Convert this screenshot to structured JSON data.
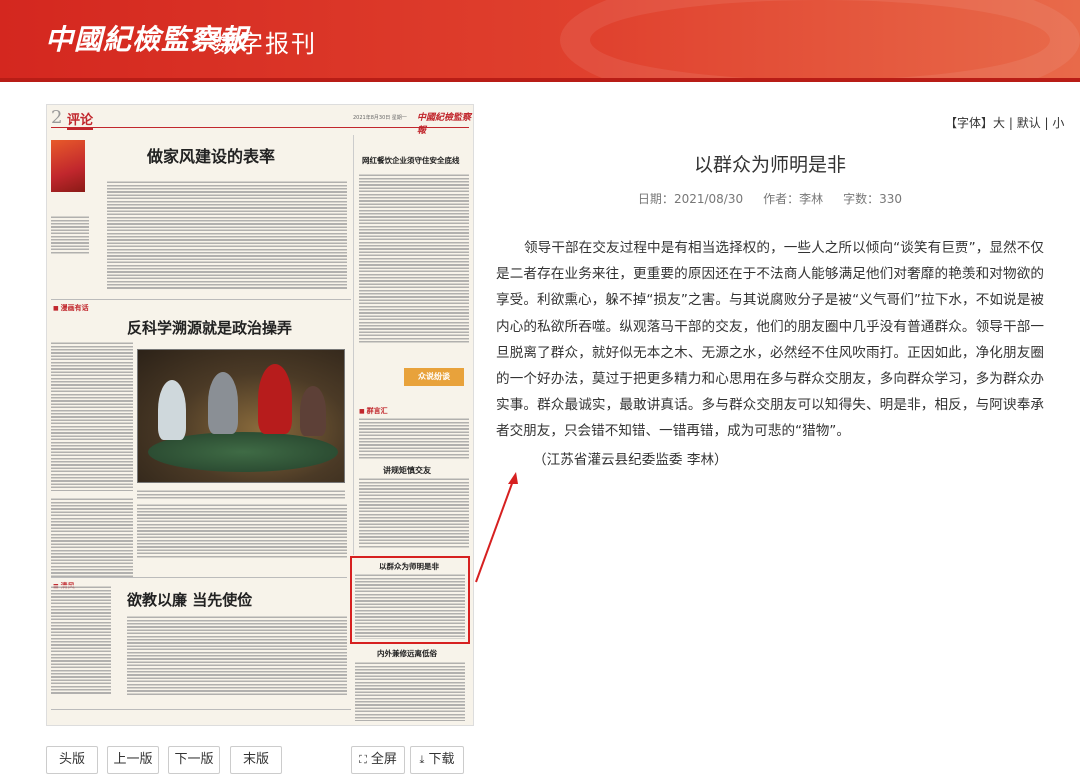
{
  "header": {
    "logo": "中國紀檢監察報",
    "subtitle": "数字报刊"
  },
  "paper": {
    "page_number": "2",
    "section": "评论",
    "date_line": "2021年8月30日  星期一",
    "masthead": "中國紀檢監察報",
    "headline_1": "做家风建设的表率",
    "headline_2": "网红餐饮企业须守住安全底线",
    "tag_1": "漫画有话",
    "headline_3": "反科学溯源就是政治操弄",
    "stamp": "众说纷谈",
    "tag_2": "群言汇",
    "headline_4": "讲规矩慎交友",
    "tag_3": "清风",
    "headline_5": "欲教以廉  当先使俭",
    "headline_6": "以群众为师明是非",
    "headline_7": "内外兼修远离低俗"
  },
  "font_controls": {
    "label": "【字体】",
    "large": "大",
    "sep1": " | ",
    "default": "默认",
    "sep2": " | ",
    "small": "小"
  },
  "article": {
    "title": "以群众为师明是非",
    "date_label": "日期：",
    "date": "2021/08/30",
    "author_label": "作者：",
    "author": "李林",
    "words_label": "字数：",
    "words": "330",
    "body": "领导干部在交友过程中是有相当选择权的，一些人之所以倾向“谈笑有巨贾”，显然不仅是二者存在业务来往，更重要的原因还在于不法商人能够满足他们对奢靡的艳羡和对物欲的享受。利欲熏心，躲不掉“损友”之害。与其说腐败分子是被“义气哥们”拉下水，不如说是被内心的私欲所吞噬。纵观落马干部的交友，他们的朋友圈中几乎没有普通群众。领导干部一旦脱离了群众，就好似无本之木、无源之水，必然经不住风吹雨打。正因如此，净化朋友圈的一个好办法，莫过于把更多精力和心思用在多与群众交朋友，多向群众学习，多为群众办实事。群众最诚实，最敢讲真话。多与群众交朋友可以知得失、明是非，相反，与阿谀奉承者交朋友，只会错不知错、一错再错，成为可悲的“猎物”。",
    "signature": "（江苏省灌云县纪委监委 李林）"
  },
  "nav": {
    "first": "头版",
    "prev": "上一版",
    "next": "下一版",
    "last": "末版",
    "fullscreen": "全屏",
    "download": "下载"
  },
  "colors": {
    "brand_red": "#d4271f",
    "highlight": "#d62020"
  }
}
